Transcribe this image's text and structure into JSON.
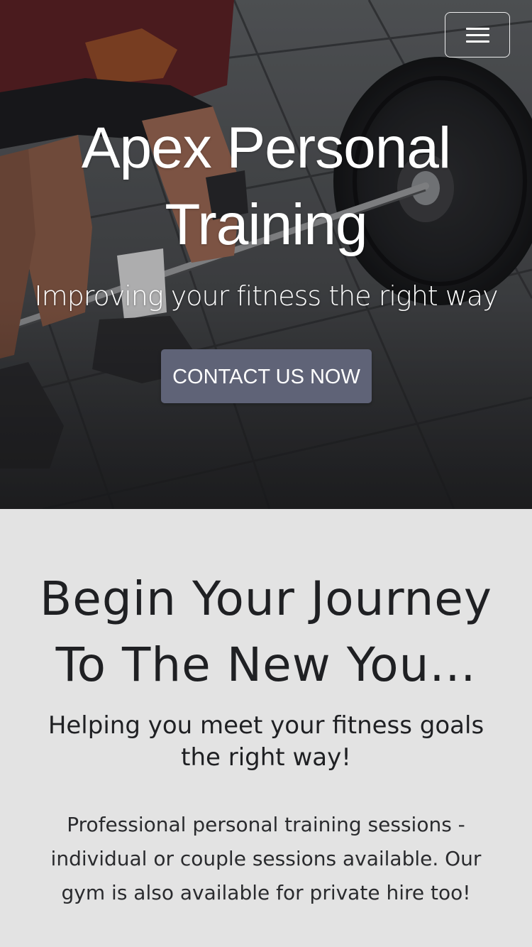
{
  "nav": {
    "menu_icon": "hamburger-menu-icon"
  },
  "hero": {
    "title": "Apex Personal Training",
    "subtitle": "Improving your fitness the right way",
    "cta_label": "CONTACT US NOW",
    "cta_color": "#5f6377"
  },
  "intro": {
    "heading": "Begin Your Journey To The New You...",
    "subheading": "Helping you meet your fitness goals the right way!",
    "body": "Professional personal training sessions - individual or couple sessions available. Our gym is also available for private hire too!"
  },
  "colors": {
    "hero_text": "#ffffff",
    "section_background": "#e3e3e3",
    "section_text": "#1f2023"
  }
}
